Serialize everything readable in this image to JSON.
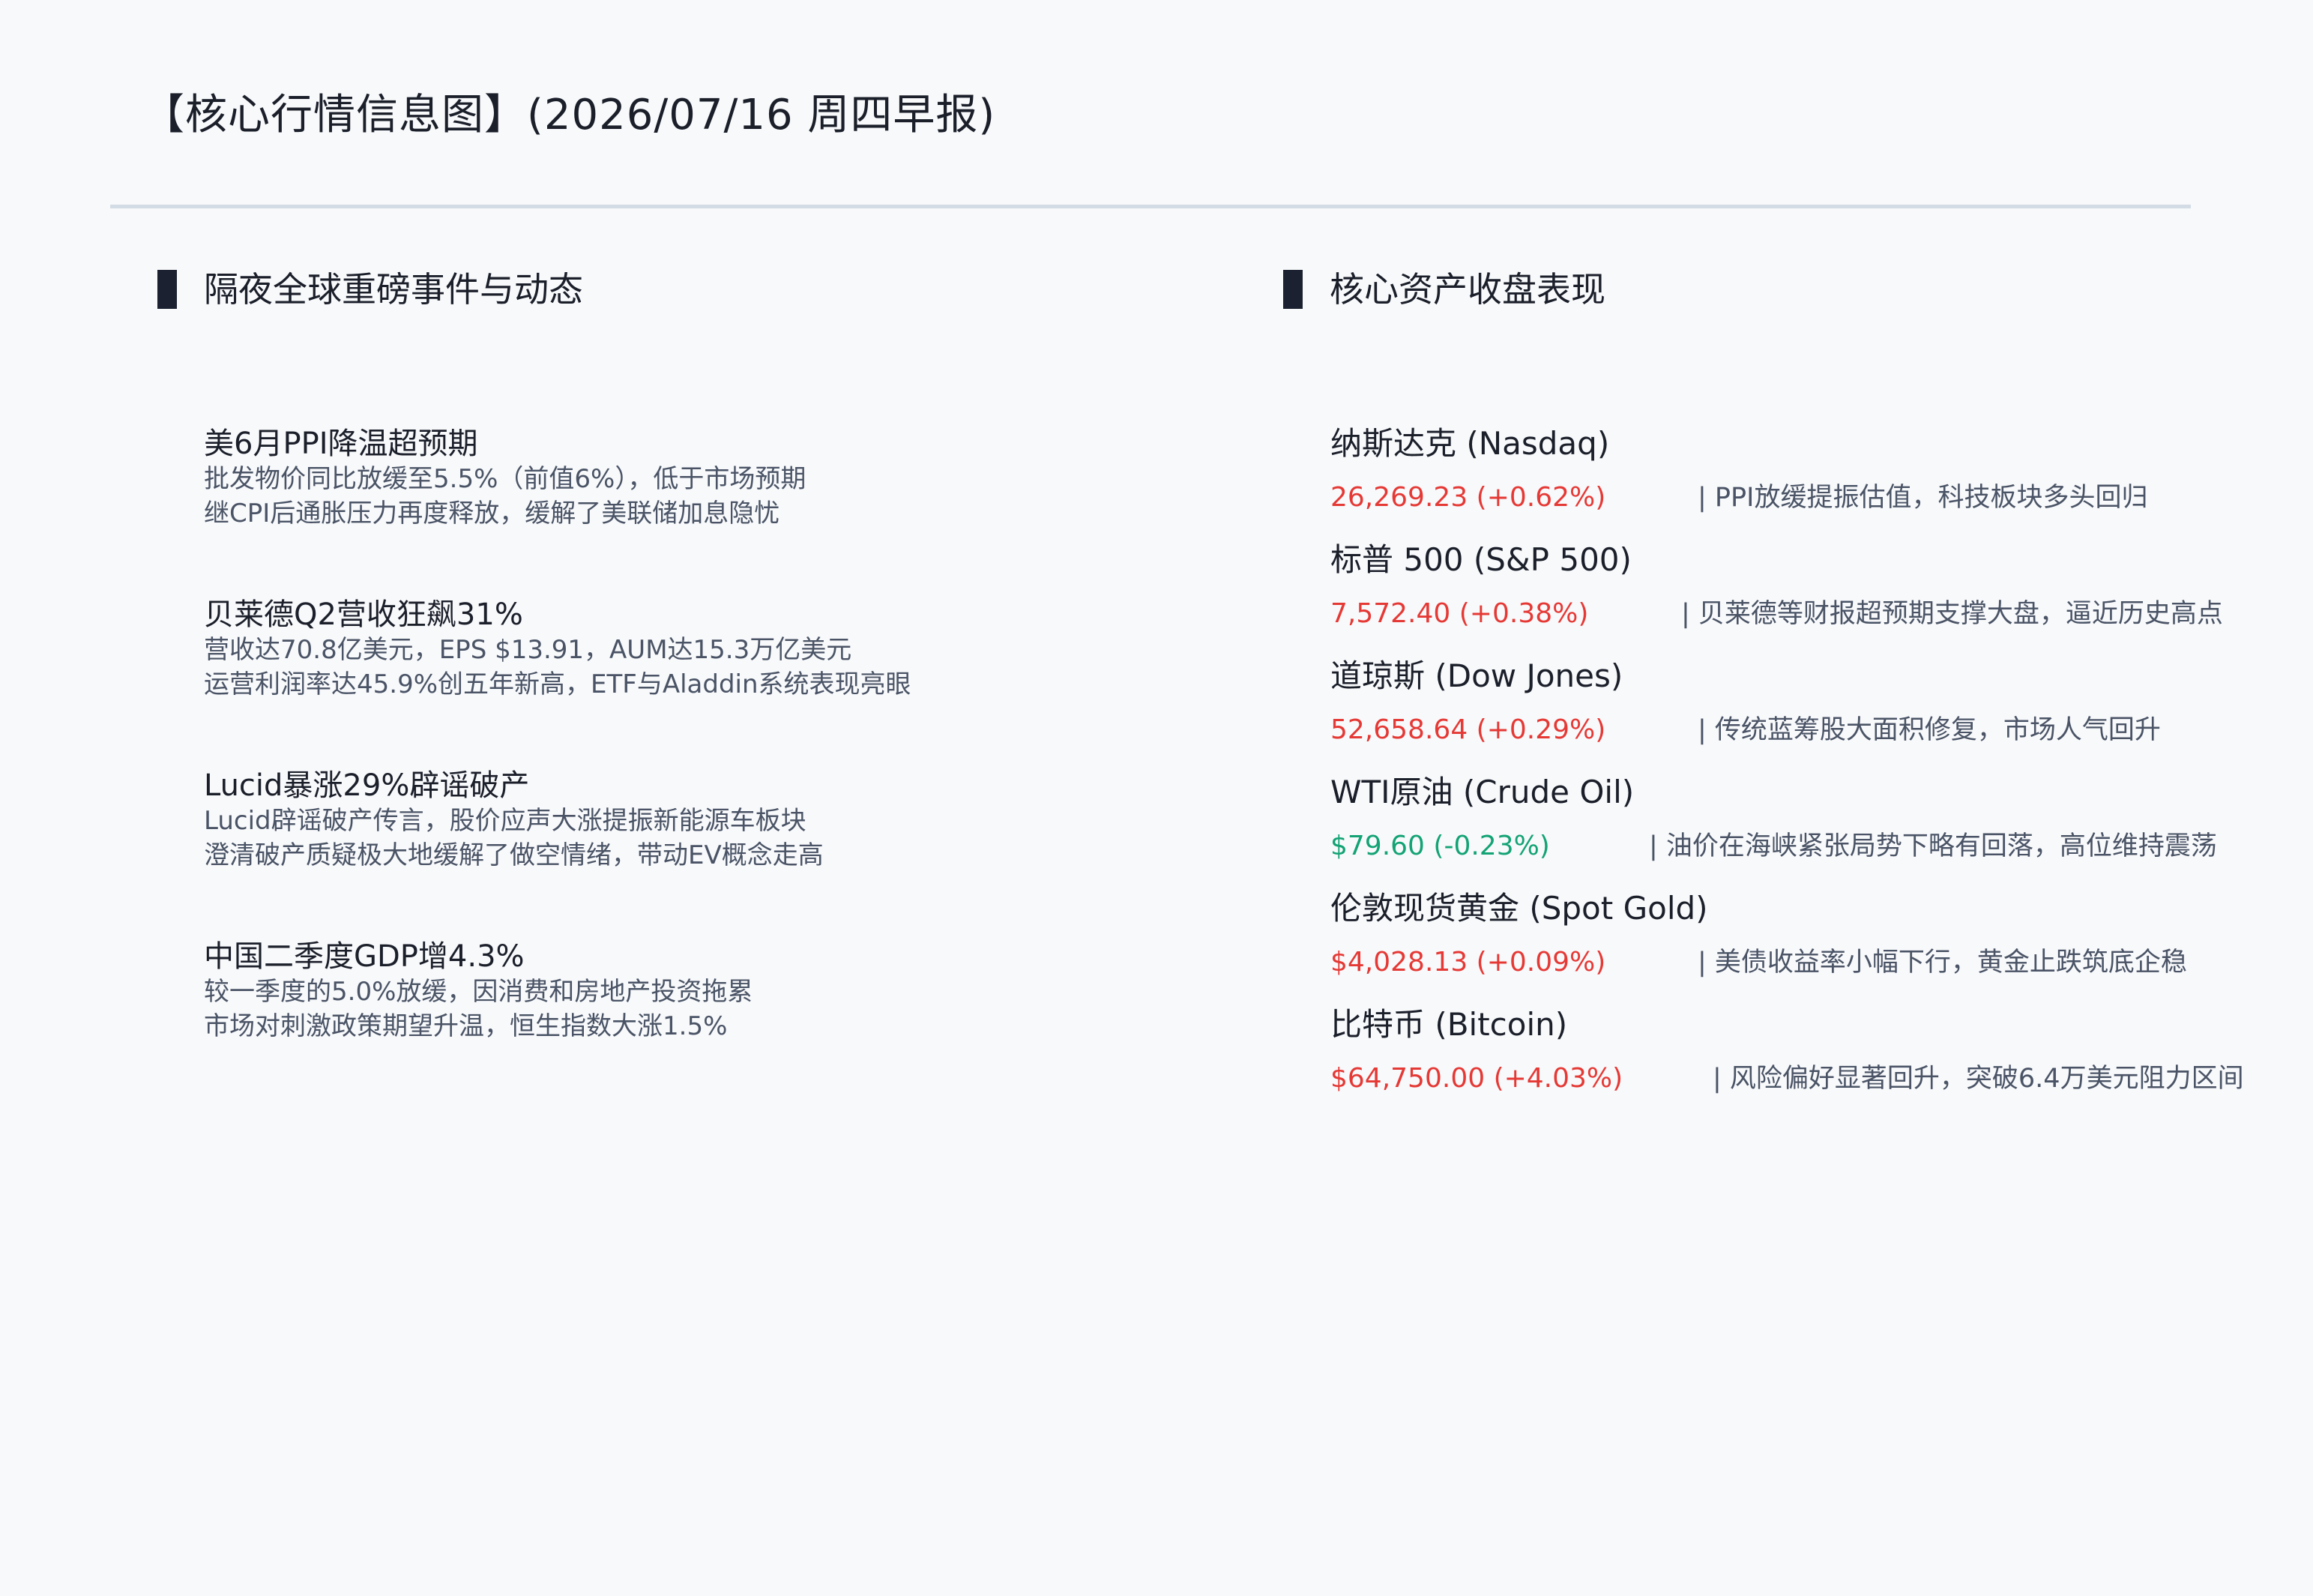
{
  "header": {
    "title": "【核心行情信息图】(2026/07/16 周四早报)"
  },
  "left_section": {
    "heading": "隔夜全球重磅事件与动态",
    "events": [
      {
        "title": "美6月PPI降温超预期",
        "lines": [
          "批发物价同比放缓至5.5%（前值6%），低于市场预期",
          "继CPI后通胀压力再度释放，缓解了美联储加息隐忧"
        ]
      },
      {
        "title": "贝莱德Q2营收狂飙31%",
        "lines": [
          "营收达70.8亿美元，EPS $13.91，AUM达15.3万亿美元",
          "运营利润率达45.9%创五年新高，ETF与Aladdin系统表现亮眼"
        ]
      },
      {
        "title": "Lucid暴涨29%辟谣破产",
        "lines": [
          "Lucid辟谣破产传言，股价应声大涨提振新能源车板块",
          "澄清破产质疑极大地缓解了做空情绪，带动EV概念走高"
        ]
      },
      {
        "title": "中国二季度GDP增4.3%",
        "lines": [
          "较一季度的5.0%放缓，因消费和房地产投资拖累",
          "市场对刺激政策期望升温，恒生指数大涨1.5%"
        ]
      }
    ]
  },
  "right_section": {
    "heading": "核心资产收盘表现",
    "up_color": "#e53935",
    "down_color": "#13a374",
    "assets": [
      {
        "name": "纳斯达克 (Nasdaq)",
        "value": "26,269.23 (+0.62%)",
        "direction": "up",
        "note": "|  PPI放缓提振估值，科技板块多头回归"
      },
      {
        "name": "标普 500 (S&P 500)",
        "value": "7,572.40 (+0.38%)",
        "direction": "up",
        "note": "|  贝莱德等财报超预期支撑大盘，逼近历史高点"
      },
      {
        "name": "道琼斯 (Dow Jones)",
        "value": "52,658.64 (+0.29%)",
        "direction": "up",
        "note": "|  传统蓝筹股大面积修复，市场人气回升"
      },
      {
        "name": "WTI原油 (Crude Oil)",
        "value": "$79.60 (-0.23%)",
        "direction": "down",
        "note": "|  油价在海峡紧张局势下略有回落，高位维持震荡"
      },
      {
        "name": "伦敦现货黄金 (Spot Gold)",
        "value": "$4,028.13 (+0.09%)",
        "direction": "up",
        "note": "|  美债收益率小幅下行，黄金止跌筑底企稳"
      },
      {
        "name": "比特币 (Bitcoin)",
        "value": "$64,750.00 (+4.03%)",
        "direction": "up",
        "note": "|  风险偏好显著回升，突破6.4万美元阻力区间"
      }
    ]
  }
}
